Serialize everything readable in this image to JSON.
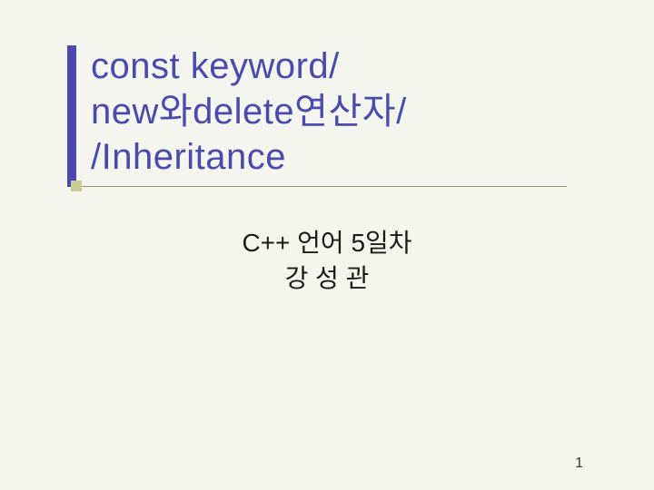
{
  "title": {
    "line1": "const keyword/",
    "line2": "new와delete연산자/",
    "line3": "/Inheritance"
  },
  "subtitle": {
    "line1": "C++ 언어 5일차",
    "line2": "강 성 관"
  },
  "page_number": "1"
}
